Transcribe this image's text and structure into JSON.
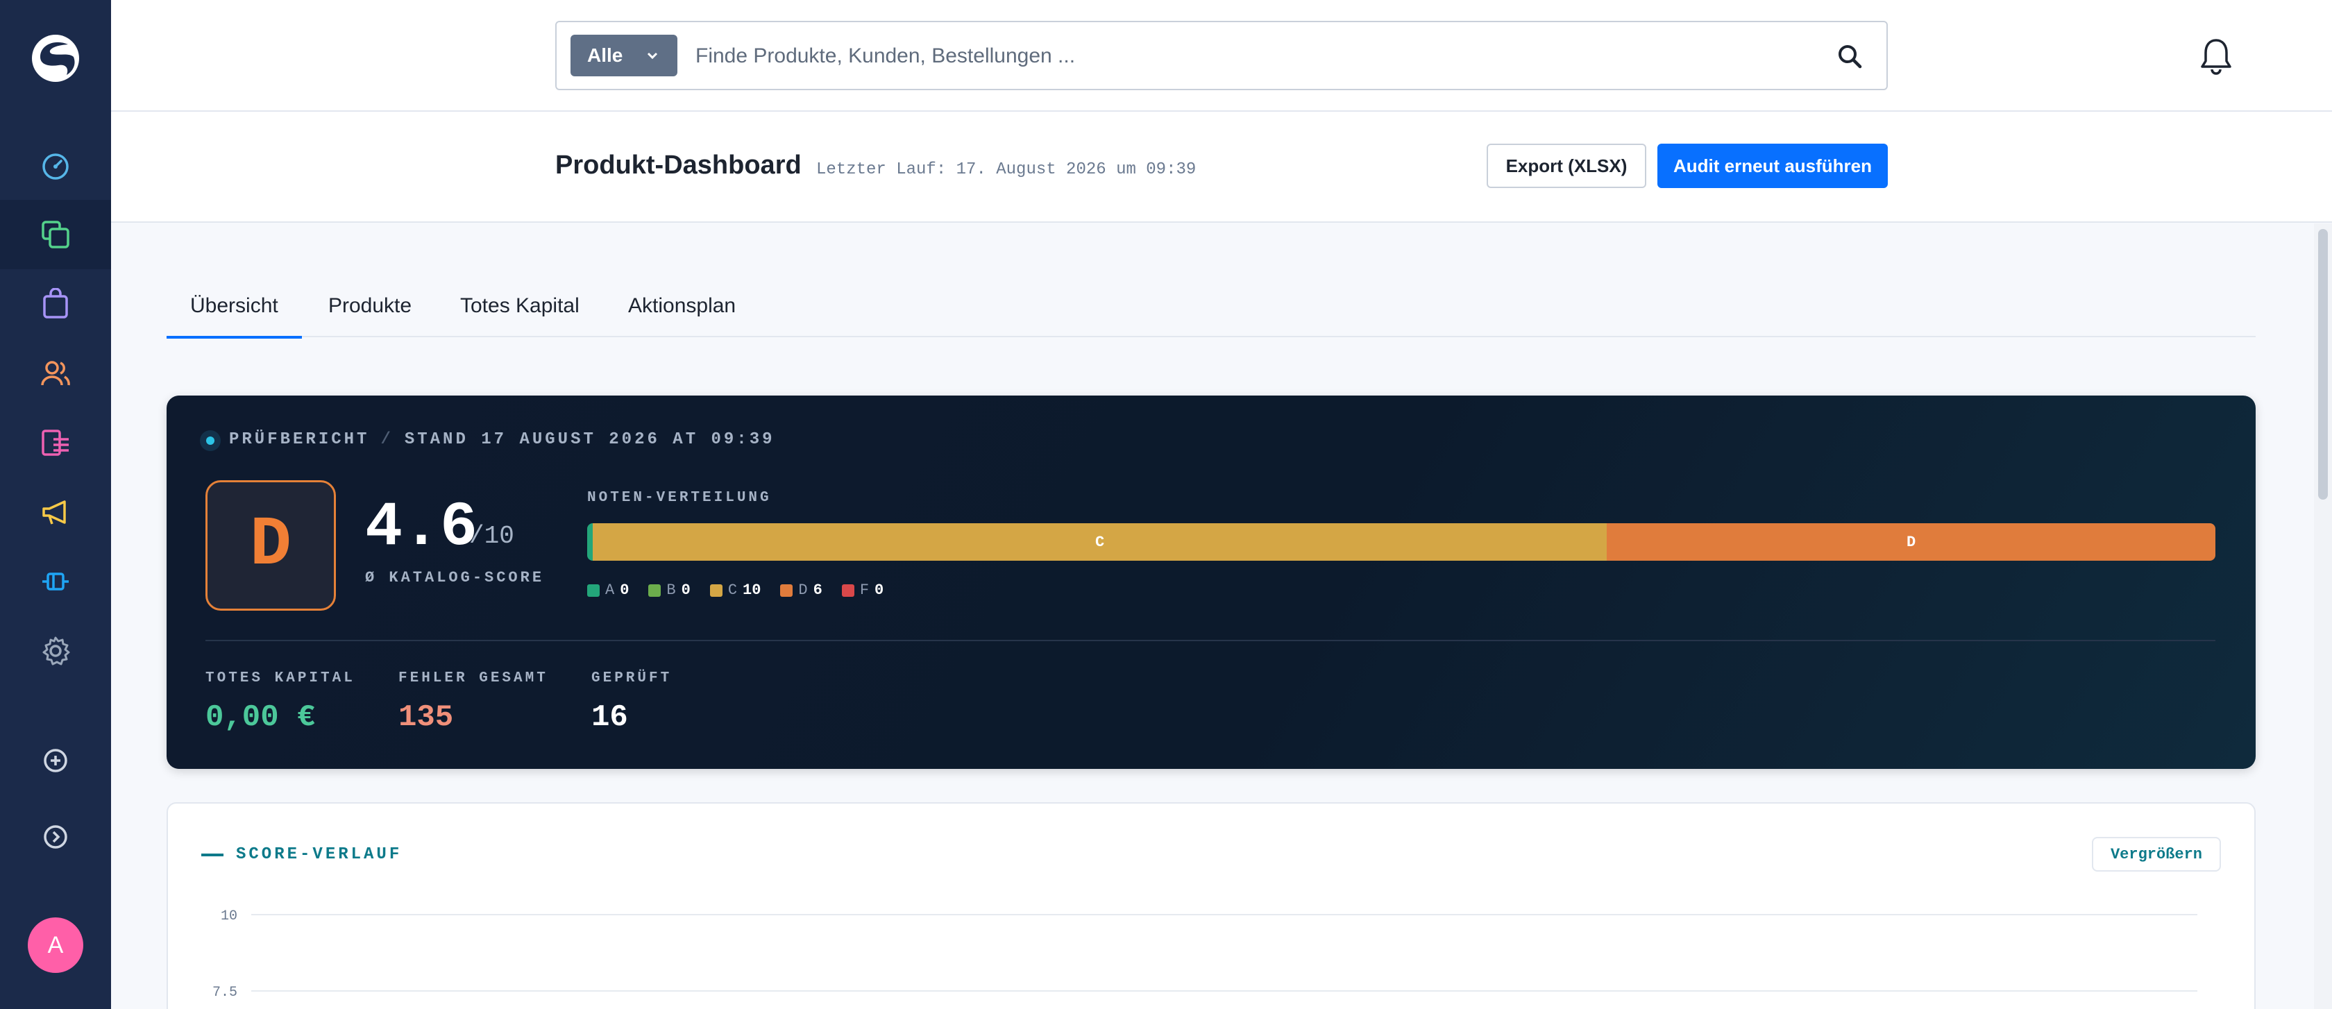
{
  "sidebar": {
    "logo": "shopware-logo-icon",
    "items": [
      {
        "name": "dashboard-icon",
        "color": "#56b6e8",
        "active": false
      },
      {
        "name": "catalog-icon",
        "color": "#54d28b",
        "active": true
      },
      {
        "name": "orders-icon",
        "color": "#a794f7",
        "active": false
      },
      {
        "name": "customers-icon",
        "color": "#f4955c",
        "active": false
      },
      {
        "name": "content-icon",
        "color": "#ee61b2",
        "active": false
      },
      {
        "name": "marketing-icon",
        "color": "#f7c948",
        "active": false
      },
      {
        "name": "extensions-icon",
        "color": "#1fa5f5",
        "active": false
      },
      {
        "name": "settings-icon",
        "color": "#9aa7ba",
        "active": false
      }
    ],
    "add_icon": "plus-circle-icon",
    "expand_icon": "chevron-right-circle-icon",
    "avatar_initial": "A"
  },
  "topbar": {
    "search_scope": "Alle",
    "search_placeholder": "Finde Produkte, Kunden, Bestellungen ..."
  },
  "page": {
    "title": "Produkt-Dashboard",
    "last_run": "Letzter Lauf: 17. August 2026 um 09:39",
    "export_label": "Export (XLSX)",
    "audit_label": "Audit erneut ausführen"
  },
  "tabs": [
    {
      "label": "Übersicht",
      "active": true
    },
    {
      "label": "Produkte",
      "active": false
    },
    {
      "label": "Totes Kapital",
      "active": false
    },
    {
      "label": "Aktionsplan",
      "active": false
    }
  ],
  "report": {
    "kicker": "PRÜFBERICHT",
    "kicker_sep": "/",
    "kicker_date": "STAND 17 AUGUST 2026 AT 09:39",
    "grade": "D",
    "score": "4.6",
    "score_max": "/10",
    "score_label": "Ø KATALOG-SCORE",
    "distribution_label": "NOTEN-VERTEILUNG",
    "distribution": [
      {
        "grade": "A",
        "count": "0",
        "value": 0,
        "color": "#23a67a"
      },
      {
        "grade": "B",
        "count": "0",
        "value": 0,
        "color": "#6cad4c"
      },
      {
        "grade": "C",
        "count": "10",
        "value": 10,
        "color": "#d4a645"
      },
      {
        "grade": "D",
        "count": "6",
        "value": 6,
        "color": "#e07c3c"
      },
      {
        "grade": "F",
        "count": "0",
        "value": 0,
        "color": "#d9484a"
      }
    ],
    "metrics": [
      {
        "label": "TOTES KAPITAL",
        "value": "0,00 €",
        "color": "#4cc89a"
      },
      {
        "label": "FEHLER GESAMT",
        "value": "135",
        "color": "#f0907a"
      },
      {
        "label": "GEPRÜFT",
        "value": "16",
        "color": "#ffffff"
      }
    ]
  },
  "score_history": {
    "title": "SCORE-VERLAUF",
    "expand_label": "Vergrößern"
  },
  "chart_data": {
    "type": "line",
    "title": "SCORE-VERLAUF",
    "xlabel": "",
    "ylabel": "",
    "y_ticks": [
      "10",
      "7.5"
    ],
    "y_tick_values": [
      10,
      7.5
    ],
    "grid": true,
    "series": []
  }
}
